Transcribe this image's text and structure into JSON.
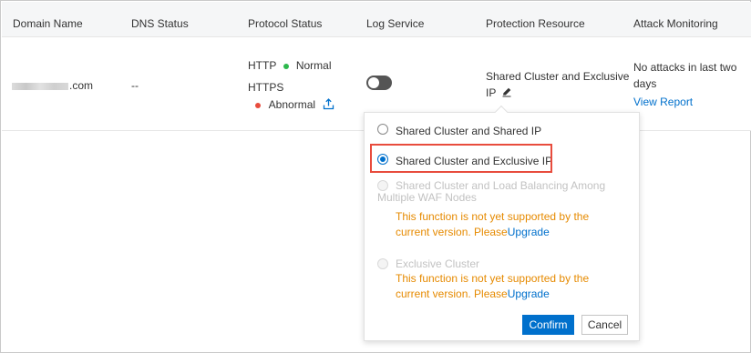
{
  "table": {
    "headers": {
      "domain": "Domain Name",
      "dns": "DNS Status",
      "protocol": "Protocol Status",
      "log": "Log Service",
      "protection": "Protection Resource",
      "attack": "Attack Monitoring"
    },
    "row": {
      "domain_suffix": ".com",
      "dns_status": "--",
      "http_label": "HTTP",
      "http_status": "Normal",
      "https_label": "HTTPS",
      "https_status": "Abnormal",
      "log_service_enabled": false,
      "protection_line1": "Shared Cluster and Exclusive",
      "protection_line2": "IP",
      "attack_line1": "No attacks in last two",
      "attack_line2": "days",
      "view_report": "View Report"
    }
  },
  "popover": {
    "options": [
      {
        "label": "Shared Cluster and Shared IP",
        "checked": false,
        "disabled": false
      },
      {
        "label": "Shared Cluster and Exclusive IP",
        "checked": true,
        "disabled": false
      },
      {
        "label_line1": "Shared Cluster and Load Balancing Among",
        "label_line2": "Multiple WAF Nodes",
        "checked": false,
        "disabled": true,
        "warn_line1": "This function is not yet supported by the",
        "warn_line2_prefix": "current version. Please",
        "upgrade": "Upgrade"
      },
      {
        "label": "Exclusive Cluster",
        "checked": false,
        "disabled": true,
        "warn_line1": "This function is not yet supported by the",
        "warn_line2_prefix": "current version. Please",
        "upgrade": "Upgrade"
      }
    ],
    "confirm": "Confirm",
    "cancel": "Cancel"
  },
  "colors": {
    "accent": "#0070cc",
    "normal_dot": "#2db84d",
    "abnormal_dot": "#e84c3d",
    "warning_text": "#e68a00",
    "highlight_border": "#e84c3d"
  }
}
